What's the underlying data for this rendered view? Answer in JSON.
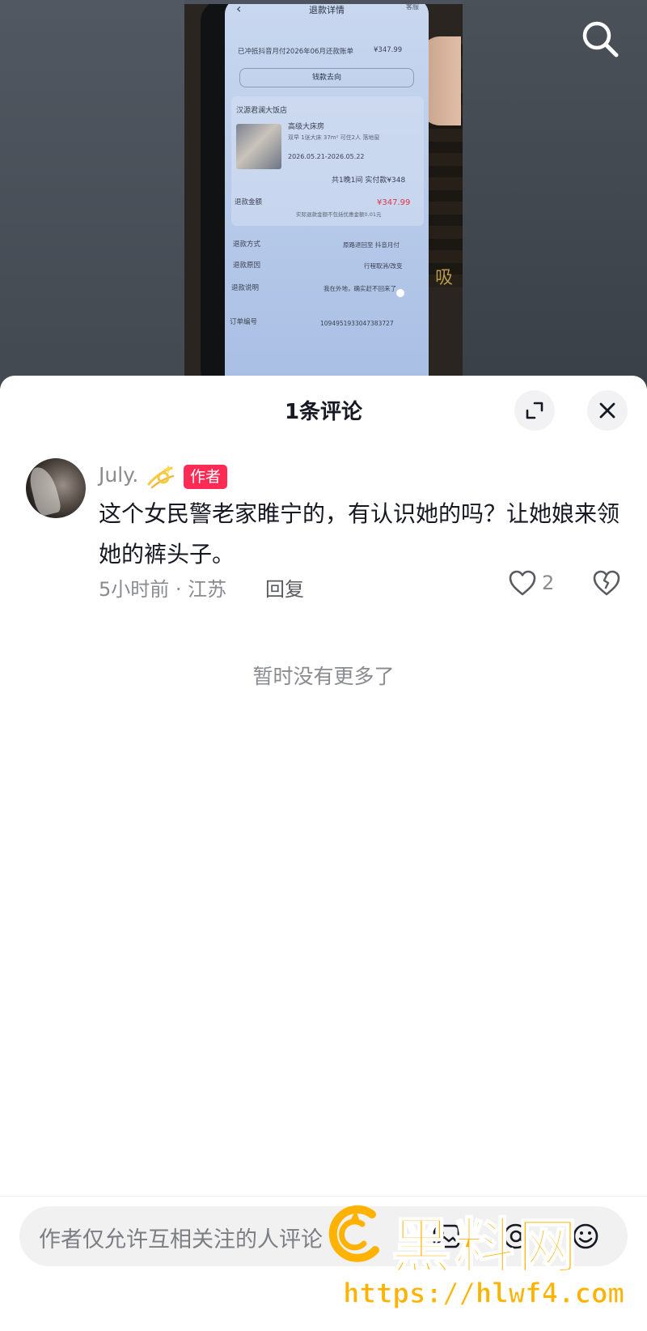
{
  "background_photo": {
    "screen": {
      "title": "退款详情",
      "help_label": "客服",
      "statement_label": "已冲抵抖音月付2026年06月还款账单",
      "statement_amount": "¥347.99",
      "money_flow_button": "钱款去向",
      "hotel_name": "汉源君澜大饭店",
      "room_name": "高级大床房",
      "room_desc": "双早 1张大床 37m² 可住2人 落地窗",
      "stay_dates": "2026.05.21-2026.05.22",
      "paid_summary": "共1晚1间  实付款¥348",
      "refund_amount_label": "退款金额",
      "refund_amount": "¥347.99",
      "refund_note": "实际退款金额不包括优惠金额0.01元",
      "refund_method_label": "退款方式",
      "refund_method": "原路退回至 抖音月付",
      "refund_reason_label": "退款原因",
      "refund_reason": "行程取消/改变",
      "refund_desc_label": "退款说明",
      "refund_desc": "我在外地，确实赶不回来了",
      "order_no_label": "订单编号",
      "order_no": "1094951933047383727"
    },
    "box_text": "吸"
  },
  "sheet": {
    "title": "1条评论",
    "comment": {
      "username": "July.",
      "author_badge": "作者",
      "text": "这个女民警老家睢宁的，有认识她的吗？让她娘来领她的裤头子。",
      "time_location": "5小时前 · 江苏",
      "reply_label": "回复",
      "like_count": "2"
    },
    "end_text": "暂时没有更多了"
  },
  "input": {
    "placeholder": "作者仅允许互相关注的人评论"
  },
  "watermark": {
    "brand": "黑料网",
    "url": "https://hlwf4.com"
  },
  "icons": {
    "search": "search-icon",
    "expand": "expand-icon",
    "close": "close-icon",
    "like": "heart-icon",
    "dislike": "broken-heart-icon",
    "image": "image-icon",
    "mention": "at-icon",
    "emoji": "emoji-icon"
  },
  "colors": {
    "accent": "#fe2c55",
    "text_primary": "#161823",
    "text_secondary": "#8a8b91",
    "watermark": "#ffb300"
  }
}
